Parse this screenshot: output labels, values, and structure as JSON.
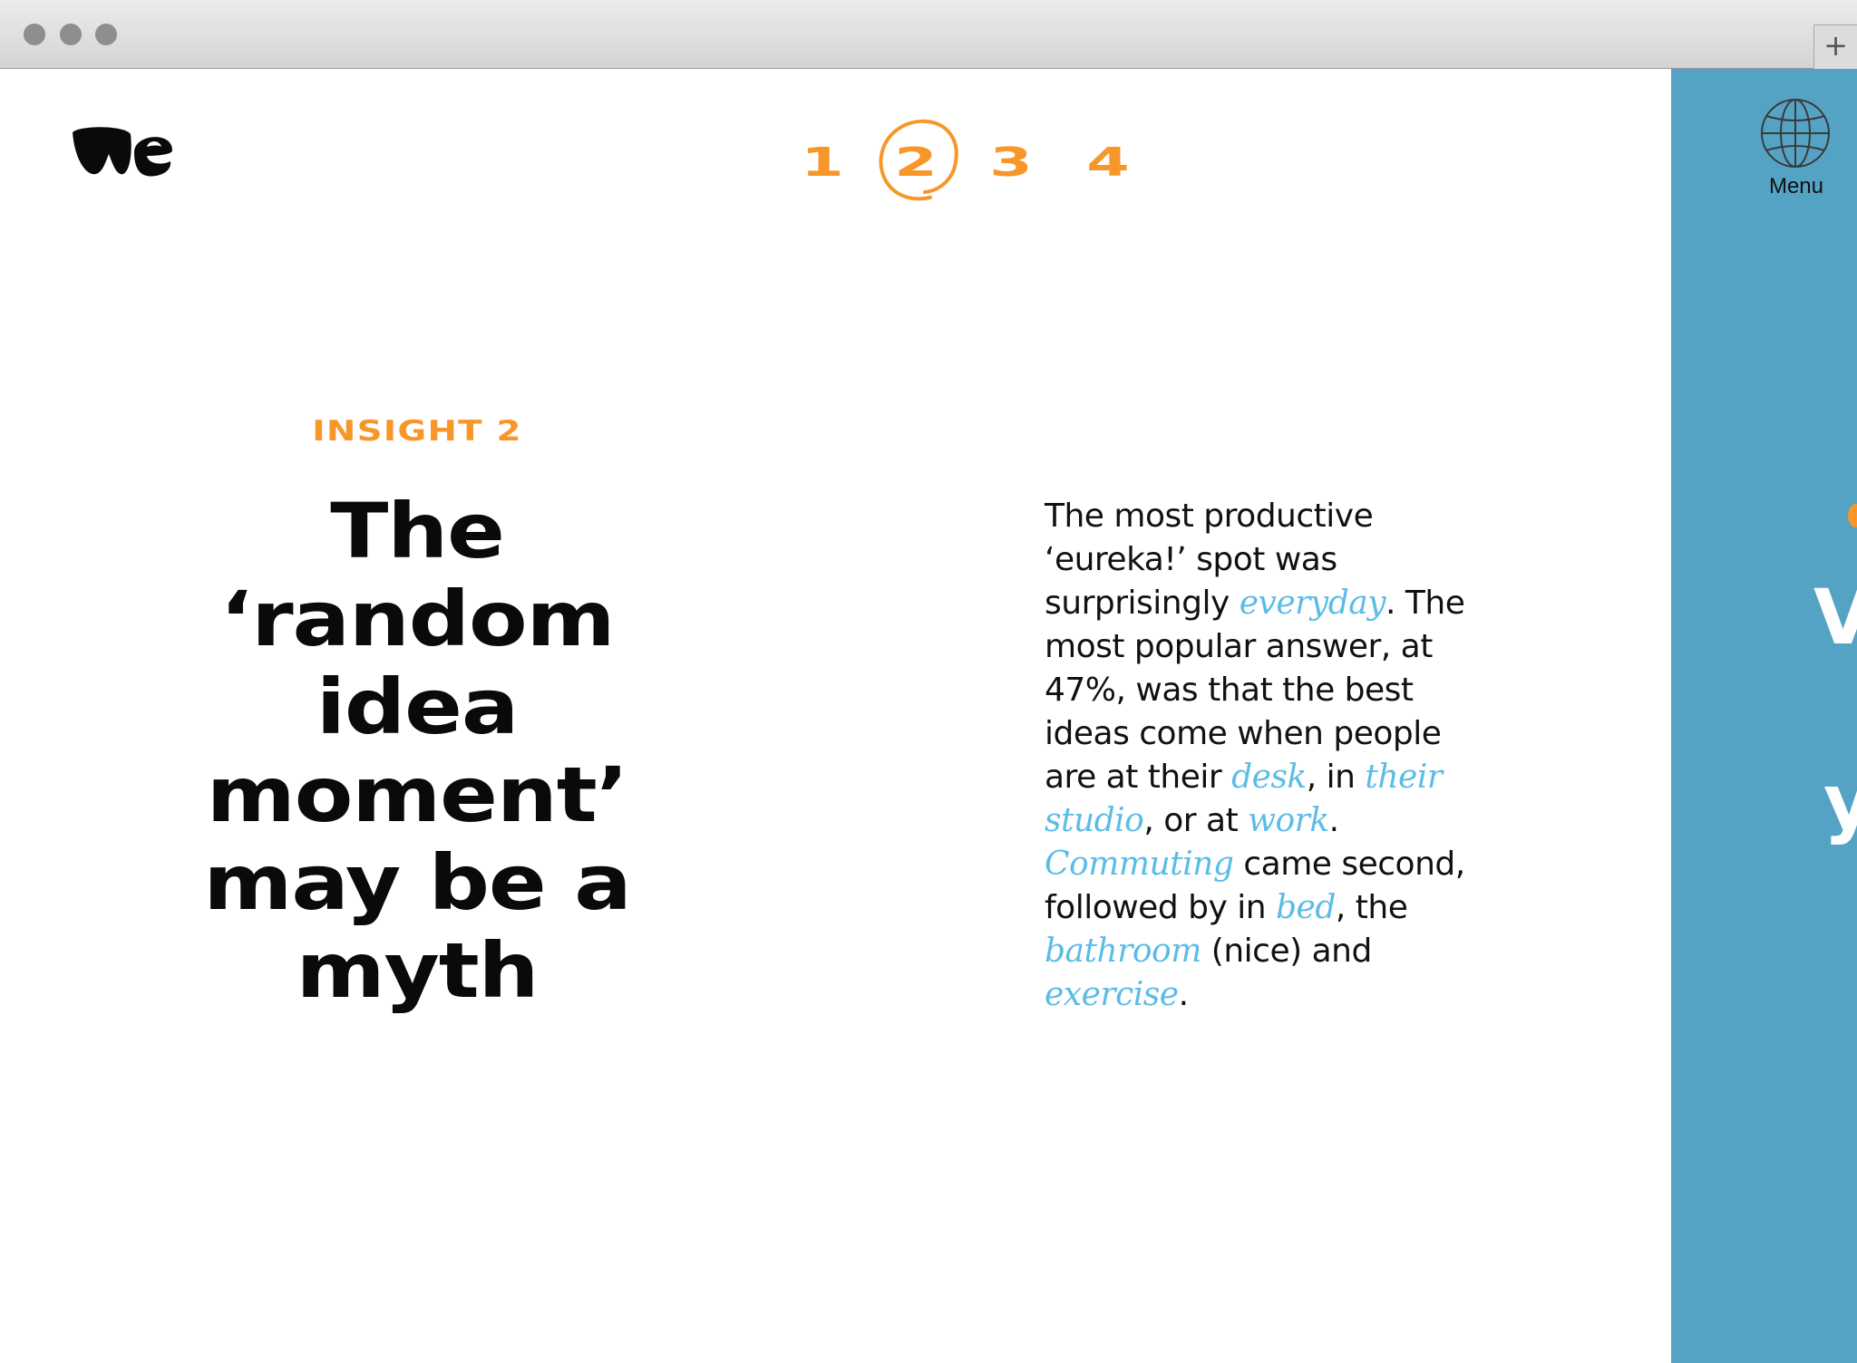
{
  "browser": {
    "new_tab_label": "+"
  },
  "header": {
    "logo_text": "we",
    "pager": {
      "items": [
        "1",
        "2",
        "3",
        "4"
      ],
      "current": "2"
    }
  },
  "insight": {
    "eyebrow": "INSIGHT 2",
    "headline_lines": [
      "The",
      "‘random",
      "idea",
      "moment’",
      "may be a",
      "myth"
    ]
  },
  "body": {
    "segments": [
      {
        "t": "The most productive ‘eureka!’ spot was surprisingly ",
        "h": false
      },
      {
        "t": "everyday",
        "h": true
      },
      {
        "t": ". The most popular answer, at 47%, was that the best ideas come when people are at their ",
        "h": false
      },
      {
        "t": "desk",
        "h": true
      },
      {
        "t": ", in ",
        "h": false
      },
      {
        "t": "their studio",
        "h": true
      },
      {
        "t": ", or at ",
        "h": false
      },
      {
        "t": "work",
        "h": true
      },
      {
        "t": ". ",
        "h": false
      },
      {
        "t": "Commuting",
        "h": true
      },
      {
        "t": " came second, followed by in ",
        "h": false
      },
      {
        "t": "bed",
        "h": true
      },
      {
        "t": ", the ",
        "h": false
      },
      {
        "t": "bathroom",
        "h": true
      },
      {
        "t": " (nice) and ",
        "h": false
      },
      {
        "t": "exercise",
        "h": true
      },
      {
        "t": ".",
        "h": false
      }
    ]
  },
  "side_panel": {
    "menu_label": "Menu",
    "globe_icon": "globe-icon",
    "peek_letters": [
      "V",
      "y"
    ]
  },
  "colors": {
    "accent_orange": "#f7972a",
    "highlight_blue": "#5bbce6",
    "panel_blue": "#55a3c4"
  }
}
